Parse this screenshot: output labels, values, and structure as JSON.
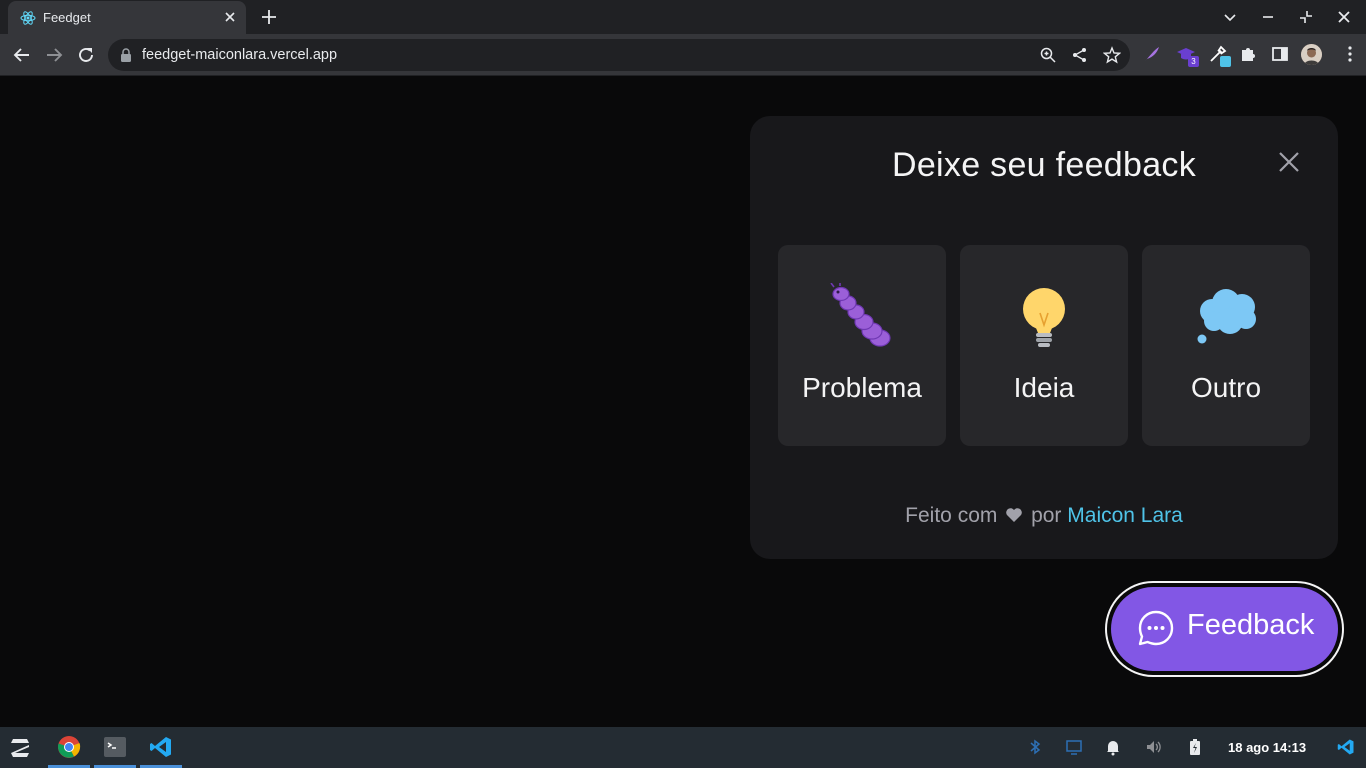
{
  "browser": {
    "tab_title": "Feedget",
    "url": "feedget-maiconlara.vercel.app",
    "extension_badge": "3"
  },
  "widget": {
    "title": "Deixe seu feedback",
    "types": [
      {
        "label": "Problema",
        "icon": "bug-icon"
      },
      {
        "label": "Ideia",
        "icon": "lightbulb-icon"
      },
      {
        "label": "Outro",
        "icon": "thought-balloon-icon"
      }
    ],
    "footer": {
      "made_with": "Feito com",
      "by": "por",
      "author": "Maicon Lara"
    }
  },
  "feedback_button": {
    "label": "Feedback"
  },
  "taskbar": {
    "clock": "18 ago 14:13"
  },
  "colors": {
    "brand": "#8257e5",
    "surface": "#18181b",
    "card": "#27272a",
    "link": "#4fc3e8"
  }
}
